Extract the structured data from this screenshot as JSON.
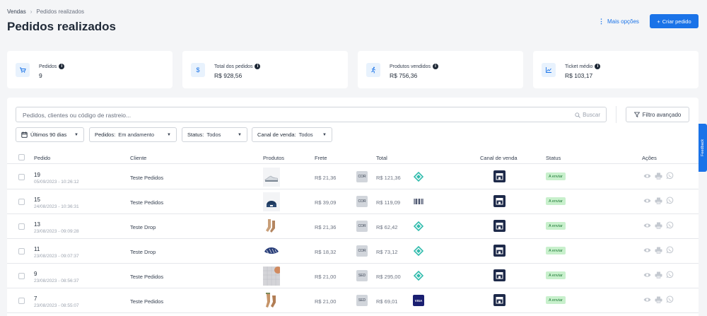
{
  "breadcrumb": {
    "first": "Vendas",
    "separator": "›",
    "current": "Pedidos realizados"
  },
  "page_title": "Pedidos realizados",
  "header_actions": {
    "more_options": "Mais opções",
    "create_order": "Criar pedido",
    "create_icon": "+"
  },
  "stats": [
    {
      "label": "Pedidos",
      "value": "9",
      "icon": "cart-icon"
    },
    {
      "label": "Total dos pedidos",
      "value": "R$ 928,56",
      "icon": "dollar-icon"
    },
    {
      "label": "Produtos vendidos",
      "value": "R$ 756,36",
      "icon": "person-running-icon"
    },
    {
      "label": "Ticket médio",
      "value": "R$ 103,17",
      "icon": "chart-icon"
    }
  ],
  "search": {
    "placeholder": "Pedidos, clientes ou código de rastreio...",
    "button": "Buscar"
  },
  "advanced_filter": "Filtro avançado",
  "filters": {
    "period": "Últimos 90 dias",
    "orders_label": "Pedidos:",
    "orders_value": "Em andamento",
    "status_label": "Status:",
    "status_value": "Todos",
    "channel_label": "Canal de venda:",
    "channel_value": "Todos"
  },
  "columns": {
    "order": "Pedido",
    "client": "Cliente",
    "products": "Produtos",
    "freight": "Frete",
    "total": "Total",
    "channel": "Canal de venda",
    "status": "Status",
    "actions": "Ações"
  },
  "rows": [
    {
      "number": "19",
      "date": "05/09/2023 - 10:26:12",
      "client": "Teste Pedidos",
      "freight": "R$ 21,36",
      "ship": "COR",
      "total": "R$ 121,36",
      "payment": "pix",
      "status": "A enviar",
      "product": "sneaker"
    },
    {
      "number": "15",
      "date": "24/08/2023 - 10:36:31",
      "client": "Teste Pedidos",
      "freight": "R$ 39,09",
      "ship": "COR",
      "total": "R$ 119,09",
      "payment": "boleto",
      "status": "A enviar",
      "product": "beanie"
    },
    {
      "number": "13",
      "date": "23/08/2023 - 09:09:28",
      "client": "Teste Drop",
      "freight": "R$ 21,36",
      "ship": "COR",
      "total": "R$ 62,42",
      "payment": "pix",
      "status": "A enviar",
      "product": "socks"
    },
    {
      "number": "11",
      "date": "23/08/2023 - 09:07:37",
      "client": "Teste Drop",
      "freight": "R$ 18,32",
      "ship": "COR",
      "total": "R$ 73,12",
      "payment": "pix",
      "status": "A enviar",
      "product": "cap"
    },
    {
      "number": "9",
      "date": "23/08/2023 - 08:56:37",
      "client": "Teste Pedidos",
      "freight": "R$ 21,00",
      "ship": "SED",
      "total": "R$ 295,00",
      "payment": "pix",
      "status": "A enviar",
      "product": "fabric"
    },
    {
      "number": "7",
      "date": "23/08/2023 - 08:55:07",
      "client": "Teste Pedidos",
      "freight": "R$ 21,00",
      "ship": "SED",
      "total": "R$ 69,01",
      "payment": "visa",
      "status": "A enviar",
      "product": "socks2"
    }
  ],
  "card_brand": "VISA",
  "feedback_tab": "Feedback",
  "colors": {
    "accent": "#1a73e8",
    "channel": "#1e2a4a",
    "status_bg": "#c8f0cc",
    "status_text": "#1e7a36",
    "pix": "#32bcad"
  }
}
